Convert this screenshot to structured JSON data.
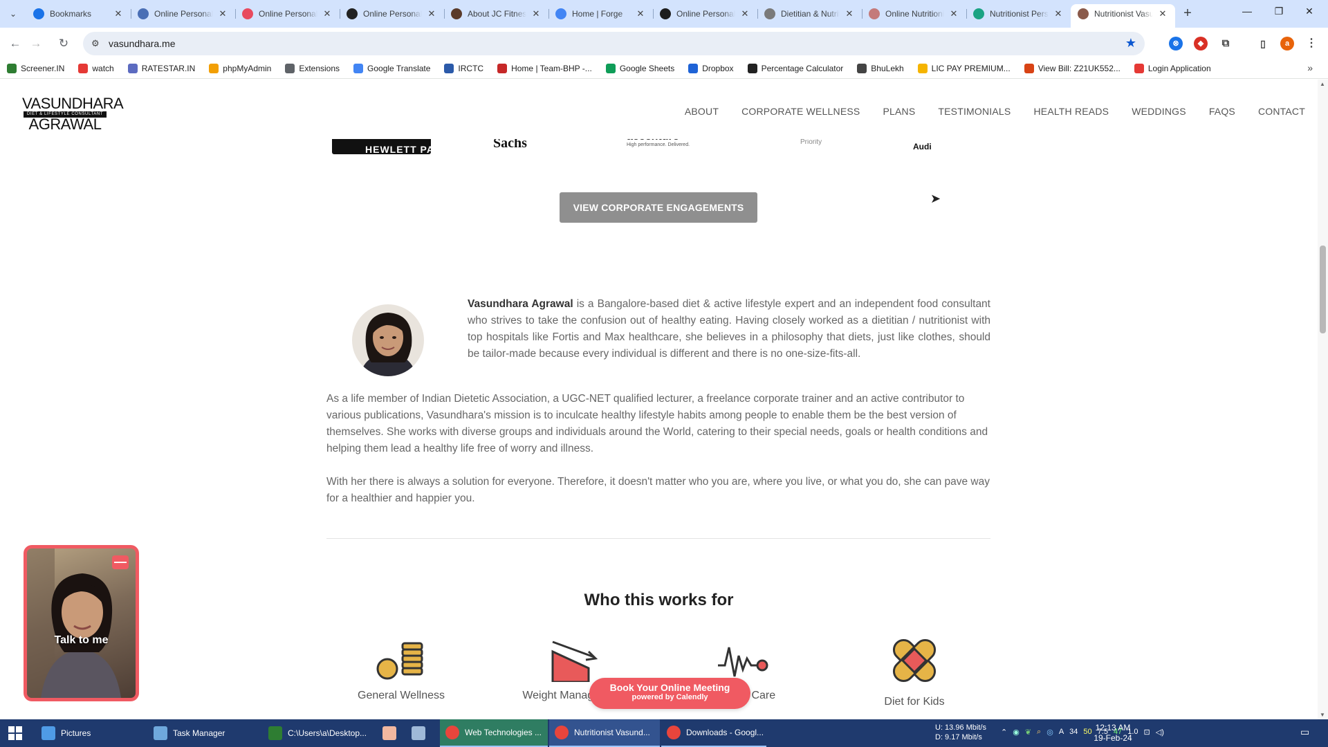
{
  "browser": {
    "tabs": [
      {
        "title": "Bookmarks",
        "favicon_color": "#1a73e8",
        "favicon": "star-icon"
      },
      {
        "title": "Online Personal Trainer",
        "favicon_color": "#4a6fb5",
        "favicon": "person-icon"
      },
      {
        "title": "Online Personal Trainer",
        "favicon_color": "#e84a5f",
        "favicon": "target-icon"
      },
      {
        "title": "Online Personal Trainer",
        "favicon_color": "#222222",
        "favicon": "globe-icon"
      },
      {
        "title": "About JC Fitness",
        "favicon_color": "#5a3a2a",
        "favicon": "fitness-icon"
      },
      {
        "title": "Home | Forge",
        "favicon_color": "#4285f4",
        "favicon": "globe-icon"
      },
      {
        "title": "Online Personal Trainer",
        "favicon_color": "#1d1d1d",
        "favicon": "wix-icon"
      },
      {
        "title": "Dietitian & Nutritionist",
        "favicon_color": "#7a7a7a",
        "favicon": "leaf-icon"
      },
      {
        "title": "Online Nutritionist",
        "favicon_color": "#c47a7a",
        "favicon": "a-icon"
      },
      {
        "title": "Nutritionist Personal",
        "favicon_color": "#1aa383",
        "favicon": "drop-icon"
      },
      {
        "title": "Nutritionist Vasundhara",
        "favicon_color": "#8a5a4a",
        "favicon": "portrait-icon",
        "active": true
      }
    ],
    "new_tab": "+",
    "window_controls": {
      "minimize": "—",
      "restore": "❐",
      "close": "✕"
    },
    "url": "vasundhara.me",
    "bookmarks": [
      {
        "label": "Screener.IN",
        "color": "#2e7d32"
      },
      {
        "label": "watch",
        "color": "#e53935"
      },
      {
        "label": "RATESTAR.IN",
        "color": "#5c6bc0"
      },
      {
        "label": "phpMyAdmin",
        "color": "#f29f05"
      },
      {
        "label": "Extensions",
        "color": "#5f6368"
      },
      {
        "label": "Google Translate",
        "color": "#4285f4"
      },
      {
        "label": "IRCTC",
        "color": "#2b5aa9"
      },
      {
        "label": "Home | Team-BHP -...",
        "color": "#c62828"
      },
      {
        "label": "Google Sheets",
        "color": "#0f9d58"
      },
      {
        "label": "Dropbox",
        "color": "#1e63d6"
      },
      {
        "label": "Percentage Calculator",
        "color": "#222222"
      },
      {
        "label": "BhuLekh",
        "color": "#444444"
      },
      {
        "label": "LIC PAY PREMIUM...",
        "color": "#f5b400"
      },
      {
        "label": "View Bill: Z21UK552...",
        "color": "#d84315"
      },
      {
        "label": "Login Application",
        "color": "#e53935"
      }
    ]
  },
  "site": {
    "logo": {
      "line1": "VASUNDHARA",
      "tagline": "DIET & LIFESTYLE CONSULTANT",
      "line2": "AGRAWAL"
    },
    "nav": [
      "ABOUT",
      "CORPORATE WELLNESS",
      "PLANS",
      "TESTIMONIALS",
      "HEALTH READS",
      "WEDDINGS",
      "FAQS",
      "CONTACT"
    ],
    "client_logos": {
      "hp": "HEWLETT PACKARD",
      "goldman": "Sachs",
      "accenture": "accenture",
      "accenture_tagline": "High performance. Delivered.",
      "priority": "Priority",
      "audi": "Audi"
    },
    "cta_button": "VIEW CORPORATE ENGAGEMENTS",
    "bio": {
      "name": "Vasundhara Agrawal",
      "intro": " is a Bangalore-based diet & active lifestyle expert and an independent food consultant who strives to take the confusion out of healthy eating. Having closely worked as a dietitian / nutritionist with top hospitals like Fortis and Max healthcare, she believes in a philosophy that diets, just like clothes, should be tailor-made because every individual is different and there is no one-size-fits-all.",
      "para2": "As a life member of Indian Dietetic Association, a UGC-NET qualified lecturer, a freelance corporate trainer and an active contributor to various publications, Vasundhara's mission is to inculcate healthy lifestyle habits among people to enable them be the best version of themselves. She works with diverse groups and individuals around the World, catering to their special needs, goals or health conditions and helping them lead a healthy life free of worry and illness.",
      "para3": "With her there is always a solution for everyone. Therefore, it doesn't matter who you are, where you live, or what you do, she can pave way for a healthier and happier you."
    },
    "who_title": "Who this works for",
    "who_items": [
      "General Wellness",
      "Weight Management",
      "Cardiac Care",
      "Diet for Kids"
    ],
    "video_widget": {
      "label": "Talk to me",
      "minimize": "—"
    },
    "calendly": {
      "line1": "Book Your Online Meeting",
      "line2": "powered by Calendly"
    }
  },
  "taskbar": {
    "items": [
      {
        "label": "Pictures",
        "color": "#4f9be6"
      },
      {
        "label": "Task Manager",
        "color": "#6fa8dc"
      },
      {
        "label": "C:\\Users\\a\\Desktop...",
        "color": "#2e7d32"
      },
      {
        "label": "",
        "color": "#f2b8a0"
      },
      {
        "label": "",
        "color": "#9fb9d8"
      },
      {
        "label": "Web Technologies ...",
        "color": "#e8453c"
      },
      {
        "label": "Nutritionist Vasund...",
        "color": "#e8453c"
      },
      {
        "label": "Downloads - Googl...",
        "color": "#e8453c"
      }
    ],
    "net_up": "U:  13.96 Mbit/s",
    "net_down": "D:    9.17 Mbit/s",
    "tray_values": [
      "50",
      "7.5",
      "47",
      "1.0"
    ],
    "time": "12:13 AM",
    "date": "19-Feb-24"
  }
}
